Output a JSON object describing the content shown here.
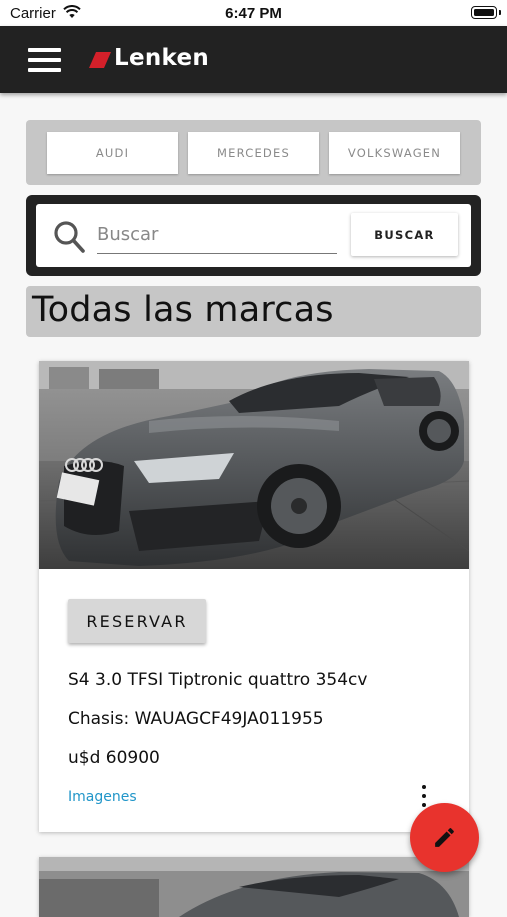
{
  "status_bar": {
    "carrier": "Carrier",
    "time": "6:47 PM"
  },
  "app_bar": {
    "brand": "Lenken",
    "brand_color": "#d4202a"
  },
  "brand_filters": [
    "AUDI",
    "MERCEDES",
    "VOLKSWAGEN"
  ],
  "search": {
    "placeholder": "Buscar",
    "value": "",
    "button_label": "BUSCAR"
  },
  "section_title": "Todas las marcas",
  "cars": [
    {
      "image": "dark-gray-audi-photo",
      "reserve_label": "RESERVAR",
      "model": "S4 3.0 TFSI Tiptronic quattro 354cv",
      "chasis": "Chasis: WAUAGCF49JA011955",
      "price": "u$d 60900",
      "images_link": "Imagenes"
    }
  ],
  "fab": {
    "icon": "edit-pencil-icon",
    "color": "#e8332d"
  },
  "colors": {
    "app_bar": "#222222",
    "accent": "#e8332d",
    "link": "#2196c9"
  }
}
